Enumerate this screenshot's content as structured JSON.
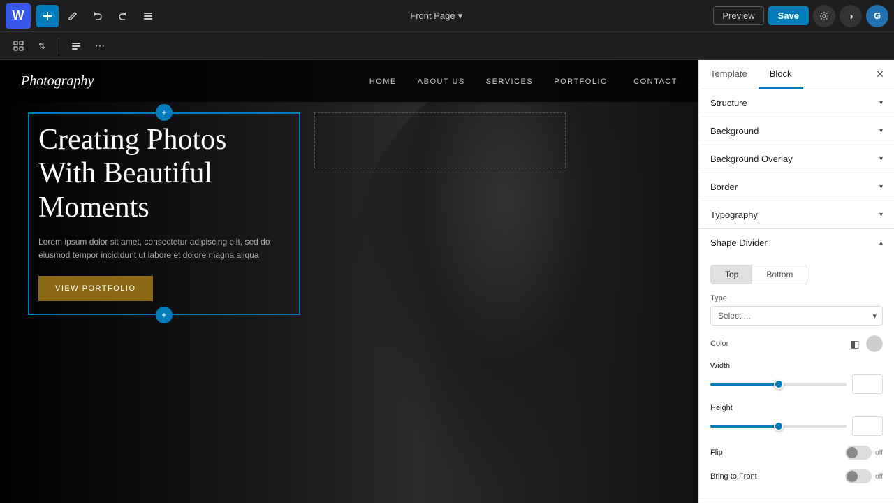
{
  "topbar": {
    "wp_logo": "W",
    "page_title": "Front Page",
    "preview_label": "Preview",
    "save_label": "Save",
    "avatar_label": "G"
  },
  "site": {
    "logo": "Photography",
    "nav_links": [
      {
        "label": "HOME",
        "has_dropdown": false
      },
      {
        "label": "ABOUT US",
        "has_dropdown": false
      },
      {
        "label": "SERVICES",
        "has_dropdown": false
      },
      {
        "label": "PORTFOLIO",
        "has_dropdown": true
      },
      {
        "label": "CONTACT",
        "has_dropdown": false
      }
    ],
    "hero_title": "Creating Photos With Beautiful Moments",
    "hero_desc": "Lorem ipsum dolor sit amet, consectetur adipiscing elit, sed do eiusmod tempor incididunt ut labore et dolore magna aliqua",
    "hero_btn_label": "VIEW PORTFOLIO"
  },
  "panel": {
    "tab_template": "Template",
    "tab_block": "Block",
    "active_tab": "Block",
    "sections": [
      {
        "id": "structure",
        "label": "Structure",
        "open": false
      },
      {
        "id": "background",
        "label": "Background",
        "open": false
      },
      {
        "id": "background_overlay",
        "label": "Background Overlay",
        "open": false
      },
      {
        "id": "border",
        "label": "Border",
        "open": false
      },
      {
        "id": "typography",
        "label": "Typography",
        "open": false
      },
      {
        "id": "shape_divider",
        "label": "Shape Divider",
        "open": true
      }
    ],
    "shape_divider": {
      "top_label": "Top",
      "bottom_label": "Bottom",
      "active_toggle": "Top",
      "type_label": "Type",
      "type_placeholder": "Select ...",
      "color_label": "Color",
      "width_label": "Width",
      "width_value": "",
      "width_fill_pct": 50,
      "height_label": "Height",
      "height_value": "",
      "height_fill_pct": 50,
      "flip_label": "Flip",
      "flip_state": "off",
      "bring_to_front_label": "Bring to Front",
      "bring_to_front_state": "off"
    }
  }
}
